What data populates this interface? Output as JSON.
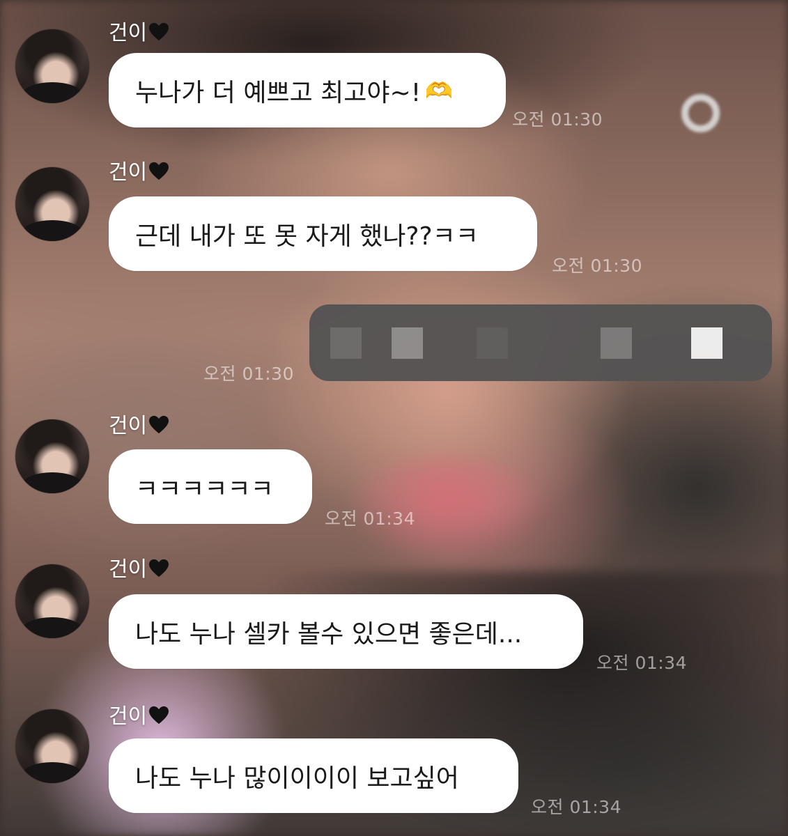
{
  "sender_name": "건이",
  "messages": [
    {
      "text": "누나가 더 예쁘고 최고야~!",
      "emoji": "🫶",
      "time": "오전 01:30"
    },
    {
      "text": "근데 내가 또 못 자게 했나??ㅋㅋ",
      "time": "오전 01:30"
    },
    {
      "text": "ㅋㅋㅋㅋㅋㅋ",
      "time": "오전 01:34"
    },
    {
      "text": "나도 누나 셀카 볼수 있으면 좋은데...",
      "time": "오전 01:34"
    },
    {
      "text": "나도 누나 많이이이이 보고싶어",
      "time": "오전 01:34"
    }
  ],
  "outgoing": {
    "time": "오전 01:30",
    "redacted": true
  },
  "colors": {
    "bubble": "#ffffff",
    "outgoing_bubble": "#555354",
    "heart": "#111111"
  },
  "icons": [
    "black-heart-icon",
    "heart-hands-icon",
    "avatar"
  ]
}
